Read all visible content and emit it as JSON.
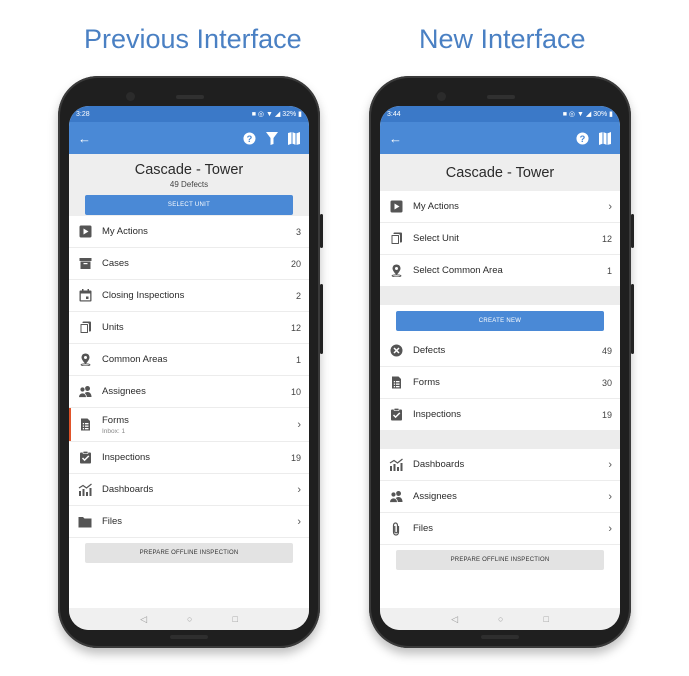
{
  "headings": {
    "left": "Previous Interface",
    "right": "New Interface"
  },
  "left_phone": {
    "status": {
      "time": "3:28",
      "battery": "32%"
    },
    "title": "Cascade - Tower",
    "subtitle": "49 Defects",
    "select_unit_button": "SELECT UNIT",
    "items": [
      {
        "label": "My Actions",
        "value": "3",
        "icon": "play-icon"
      },
      {
        "label": "Cases",
        "value": "20",
        "icon": "folder-box-icon"
      },
      {
        "label": "Closing Inspections",
        "value": "2",
        "icon": "calendar-icon"
      },
      {
        "label": "Units",
        "value": "12",
        "icon": "copy-icon"
      },
      {
        "label": "Common Areas",
        "value": "1",
        "icon": "location-icon"
      },
      {
        "label": "Assignees",
        "value": "10",
        "icon": "people-icon"
      },
      {
        "label": "Forms",
        "sub": "Inbox: 1",
        "value": "›",
        "icon": "form-icon"
      },
      {
        "label": "Inspections",
        "value": "19",
        "icon": "clipboard-check-icon"
      },
      {
        "label": "Dashboards",
        "value": "›",
        "icon": "chart-icon"
      },
      {
        "label": "Files",
        "value": "›",
        "icon": "folder-icon"
      }
    ],
    "offline_button": "PREPARE OFFLINE INSPECTION"
  },
  "right_phone": {
    "status": {
      "time": "3:44",
      "battery": "30%"
    },
    "title": "Cascade - Tower",
    "group1": [
      {
        "label": "My Actions",
        "value": "›",
        "icon": "play-icon"
      },
      {
        "label": "Select Unit",
        "value": "12",
        "icon": "copy-icon"
      },
      {
        "label": "Select Common Area",
        "value": "1",
        "icon": "location-icon"
      }
    ],
    "create_button": "CREATE NEW",
    "group2": [
      {
        "label": "Defects",
        "value": "49",
        "icon": "close-circle-icon"
      },
      {
        "label": "Forms",
        "value": "30",
        "icon": "form-icon"
      },
      {
        "label": "Inspections",
        "value": "19",
        "icon": "clipboard-check-icon"
      }
    ],
    "group3": [
      {
        "label": "Dashboards",
        "value": "›",
        "icon": "chart-icon"
      },
      {
        "label": "Assignees",
        "value": "›",
        "icon": "people-icon"
      },
      {
        "label": "Files",
        "value": "›",
        "icon": "paperclip-icon"
      }
    ],
    "offline_button": "PREPARE OFFLINE INSPECTION"
  },
  "colors": {
    "accent": "#4a89d6",
    "heading": "#4a80c3",
    "active_bar": "#e0542a"
  }
}
